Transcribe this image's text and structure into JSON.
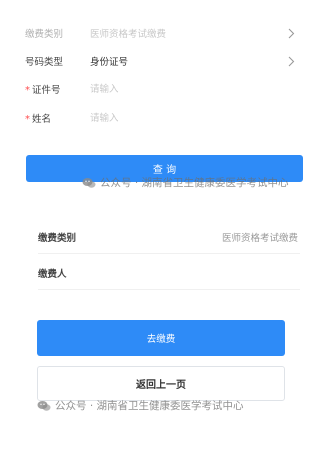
{
  "form": {
    "fee_category": {
      "label": "缴费类别",
      "value": "医师资格考试缴费"
    },
    "id_type": {
      "label": "号码类型",
      "value": "身份证号"
    },
    "id_number": {
      "required_mark": "*",
      "label": "证件号",
      "placeholder": "请输入"
    },
    "name": {
      "required_mark": "*",
      "label": "姓名",
      "placeholder": "请输入"
    },
    "query_button": "查 询"
  },
  "result": {
    "fee_category": {
      "label": "缴费类别",
      "value": "医师资格考试缴费"
    },
    "payer": {
      "label": "缴费人",
      "value": ""
    },
    "pay_button": "去缴费",
    "back_button": "返回上一页"
  },
  "watermark": {
    "text": "公众号 · 湖南省卫生健康委医学考试中心",
    "icon": "wechat-icon"
  },
  "colors": {
    "primary": "#2e8bf7",
    "required": "#ff4d4f",
    "muted": "#c8c8c8"
  }
}
